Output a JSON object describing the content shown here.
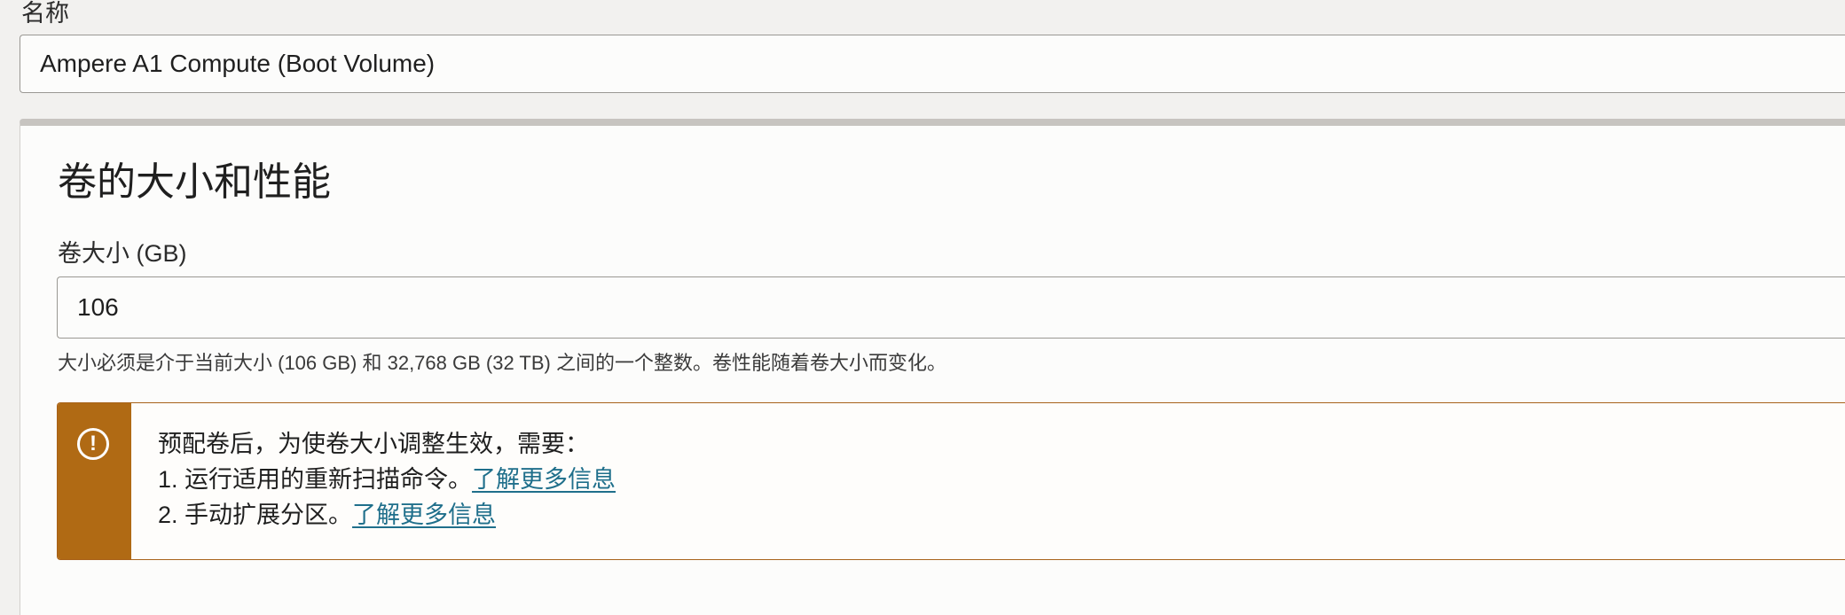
{
  "name_field": {
    "label": "名称",
    "value": "Ampere A1 Compute (Boot Volume)"
  },
  "volume_section": {
    "title": "卷的大小和性能",
    "size_label": "卷大小 (GB)",
    "size_value": "106",
    "size_help": "大小必须是介于当前大小 (106 GB) 和 32,768 GB (32 TB) 之间的一个整数。卷性能随着卷大小而变化。"
  },
  "warning": {
    "icon": "exclamation-circle-icon",
    "color": "#b06a14",
    "intro": "预配卷后，为使卷大小调整生效，需要：",
    "step1_text": "1. 运行适用的重新扫描命令。",
    "step1_link": "了解更多信息",
    "step2_text": "2. 手动扩展分区。",
    "step2_link": "了解更多信息"
  },
  "colors": {
    "link": "#1f6f8b",
    "warning_bar": "#b06a14"
  }
}
